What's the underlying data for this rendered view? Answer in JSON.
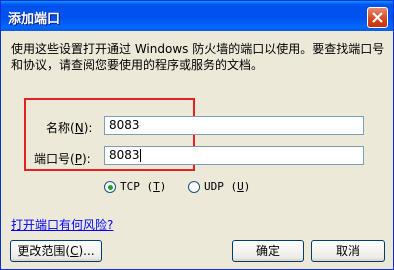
{
  "dialog": {
    "title": "添加端口",
    "description": "使用这些设置打开通过 Windows 防火墙的端口以使用。要查找端口号和协议，请查阅您要使用的程序或服务的文档。"
  },
  "form": {
    "name_label": "名称",
    "name_mnemonic": "N",
    "name_value": "8083",
    "port_label": "端口号",
    "port_mnemonic": "P",
    "port_value": "8083"
  },
  "protocol": {
    "tcp_label": "TCP",
    "tcp_mnemonic": "T",
    "udp_label": "UDP",
    "udp_mnemonic": "U",
    "selected": "TCP"
  },
  "link": {
    "risk_text": "打开端口有何风险?"
  },
  "buttons": {
    "change_scope": "更改范围",
    "change_scope_mnemonic": "C",
    "ok": "确定",
    "cancel": "取消"
  },
  "colors": {
    "highlight": "#e52020",
    "title_bar": "#0053ee"
  }
}
